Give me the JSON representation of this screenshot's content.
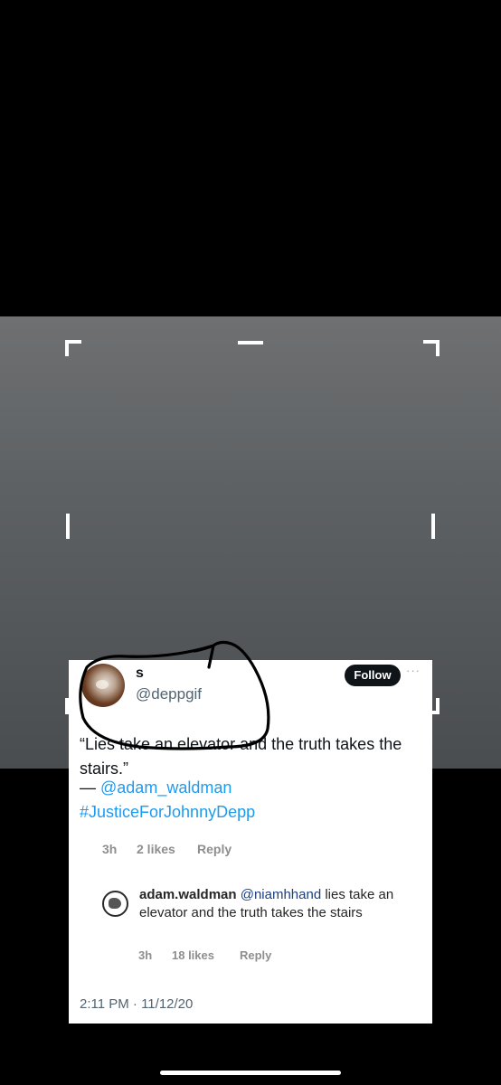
{
  "tweet": {
    "display_name": "s",
    "handle": "@deppgif",
    "follow_label": "Follow",
    "more_label": "···",
    "quote_text": "“Lies take an elevator and the truth takes the stairs.”",
    "dash": "— ",
    "quote_author": "@adam_waldman",
    "hashtag": "#JusticeForJohnnyDepp",
    "timestamp": "2:11 PM · 11/12/20"
  },
  "embedded_post": {
    "comment_meta": {
      "time": "3h",
      "likes": "2 likes",
      "reply": "Reply"
    },
    "reply": {
      "username": "adam.waldman",
      "mention": "@niamhhand",
      "text": " lies take an elevator and the truth takes the stairs",
      "time": "3h",
      "likes": "18 likes",
      "reply": "Reply"
    }
  },
  "colors": {
    "link": "#1d9bf0",
    "follow_bg": "#0f1419",
    "annotation_stroke": "#000000"
  }
}
